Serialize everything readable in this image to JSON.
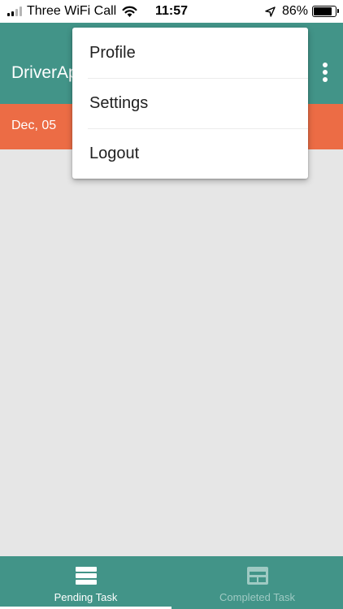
{
  "status_bar": {
    "carrier": "Three WiFi Call",
    "time": "11:57",
    "battery": "86%",
    "battery_level": 0.86,
    "signal_bars": 2,
    "icons": [
      "signal-icon",
      "wifi-icon",
      "location-arrow-icon",
      "battery-icon"
    ]
  },
  "app_bar": {
    "title": "DriverApp",
    "overflow_icon": "more-vertical-icon"
  },
  "date_strip": {
    "date": "Dec, 05"
  },
  "menu": {
    "items": [
      {
        "label": "Profile"
      },
      {
        "label": "Settings"
      },
      {
        "label": "Logout"
      }
    ]
  },
  "bottom_nav": {
    "tabs": [
      {
        "label": "Pending Task",
        "icon": "list-icon",
        "active": true
      },
      {
        "label": "Completed Task",
        "icon": "completed-list-icon",
        "active": false
      }
    ]
  },
  "colors": {
    "primary": "#429488",
    "accent": "#ec6c45",
    "background": "#e6e6e6",
    "inactive_tab_text": "#9fcac3"
  }
}
